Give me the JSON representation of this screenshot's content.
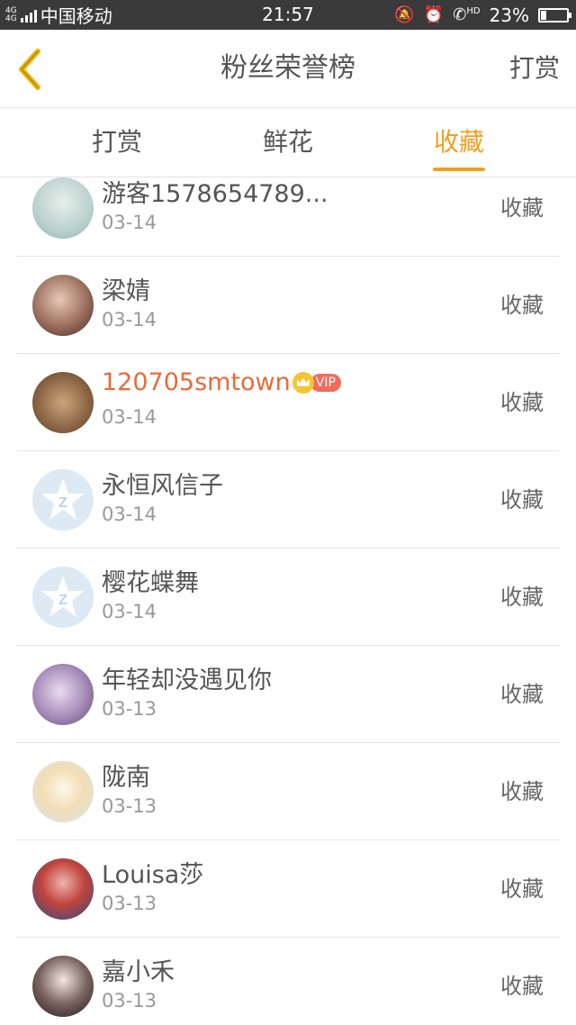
{
  "status_bar": {
    "network": "4G 4G",
    "carrier": "中国移动",
    "time": "21:57",
    "hd": "HD",
    "battery": "23%",
    "battery_level": 0.23
  },
  "nav": {
    "title": "粉丝荣誉榜",
    "right_label": "打赏"
  },
  "tabs": [
    {
      "label": "打赏",
      "active": false
    },
    {
      "label": "鲜花",
      "active": false
    },
    {
      "label": "收藏",
      "active": true
    }
  ],
  "accent_color": "#f0a020",
  "list": [
    {
      "name": "游客1578654789...",
      "date": "03-14",
      "action": "收藏",
      "avatar": "photo"
    },
    {
      "name": "梁婧",
      "date": "03-14",
      "action": "收藏",
      "avatar": "photo"
    },
    {
      "name": "120705smtown",
      "date": "03-14",
      "action": "收藏",
      "avatar": "photo",
      "vip": "VIP"
    },
    {
      "name": "永恒风信子",
      "date": "03-14",
      "action": "收藏",
      "avatar": "default-star"
    },
    {
      "name": "樱花蝶舞",
      "date": "03-14",
      "action": "收藏",
      "avatar": "default-star"
    },
    {
      "name": "年轻却没遇见你",
      "date": "03-13",
      "action": "收藏",
      "avatar": "photo"
    },
    {
      "name": "陇南",
      "date": "03-13",
      "action": "收藏",
      "avatar": "anime"
    },
    {
      "name": "Louisa莎",
      "date": "03-13",
      "action": "收藏",
      "avatar": "photo"
    },
    {
      "name": "嘉小禾",
      "date": "03-13",
      "action": "收藏",
      "avatar": "photo"
    }
  ]
}
